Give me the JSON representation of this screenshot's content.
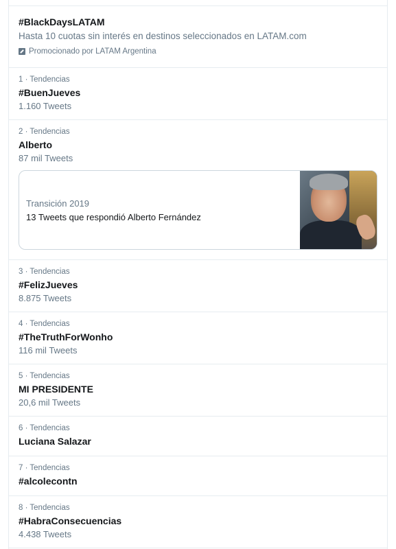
{
  "promoted": {
    "title": "#BlackDaysLATAM",
    "description": "Hasta 10 cuotas sin interés en destinos seleccionados en LATAM.com",
    "promoted_by": "Promocionado por LATAM Argentina",
    "icon": "promoted-icon"
  },
  "trends": [
    {
      "rank": "1 · Tendencias",
      "title": "#BuenJueves",
      "count": "1.160 Tweets"
    },
    {
      "rank": "2 · Tendencias",
      "title": "Alberto",
      "count": "87 mil Tweets",
      "card": {
        "topic": "Transición 2019",
        "description": "13 Tweets que respondió Alberto Fernández"
      }
    },
    {
      "rank": "3 · Tendencias",
      "title": "#FelizJueves",
      "count": "8.875 Tweets"
    },
    {
      "rank": "4 · Tendencias",
      "title": "#TheTruthForWonho",
      "count": "116 mil Tweets"
    },
    {
      "rank": "5 · Tendencias",
      "title": "MI PRESIDENTE",
      "count": "20,6 mil Tweets"
    },
    {
      "rank": "6 · Tendencias",
      "title": "Luciana Salazar",
      "count": ""
    },
    {
      "rank": "7 · Tendencias",
      "title": "#alcolecontn",
      "count": ""
    },
    {
      "rank": "8 · Tendencias",
      "title": "#HabraConsecuencias",
      "count": "4.438 Tweets"
    }
  ]
}
